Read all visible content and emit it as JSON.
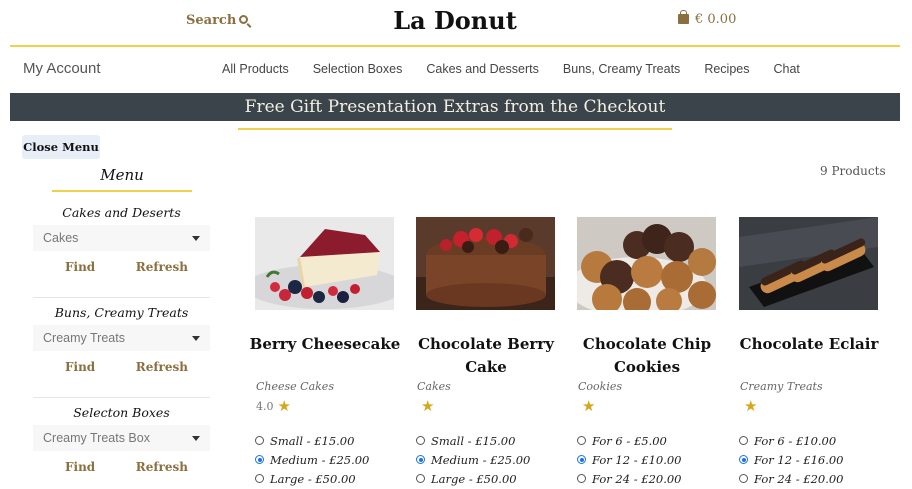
{
  "header": {
    "search_label": "Search",
    "logo": "La Donut",
    "cart_total": "€ 0.00"
  },
  "nav": {
    "account": "My Account",
    "links": [
      "All Products",
      "Selection Boxes",
      "Cakes and Desserts",
      "Buns, Creamy Treats",
      "Recipes",
      "Chat"
    ]
  },
  "banner": "Free Gift Presentation Extras from the Checkout",
  "sidebar": {
    "close_label": "Close Menu",
    "title": "Menu",
    "groups": [
      {
        "title": "Cakes and Deserts",
        "selected": "Cakes",
        "find": "Find",
        "refresh": "Refresh"
      },
      {
        "title": "Buns, Creamy Treats",
        "selected": "Creamy Treats",
        "find": "Find",
        "refresh": "Refresh"
      },
      {
        "title": "Selecton Boxes",
        "selected": "Creamy Treats Box",
        "find": "Find",
        "refresh": "Refresh"
      }
    ]
  },
  "product_count": "9 Products",
  "products": [
    {
      "name": "Berry Cheesecake",
      "category": "Cheese Cakes",
      "rating": "4.0",
      "options": [
        {
          "label": "Small - £15.00",
          "selected": false
        },
        {
          "label": "Medium - £25.00",
          "selected": true
        },
        {
          "label": "Large - £50.00",
          "selected": false
        }
      ]
    },
    {
      "name": "Chocolate Berry Cake",
      "category": "Cakes",
      "rating": "",
      "options": [
        {
          "label": "Small - £15.00",
          "selected": false
        },
        {
          "label": "Medium - £25.00",
          "selected": true
        },
        {
          "label": "Large - £50.00",
          "selected": false
        }
      ]
    },
    {
      "name": "Chocolate Chip Cookies",
      "category": "Cookies",
      "rating": "",
      "options": [
        {
          "label": "For 6 - £5.00",
          "selected": false
        },
        {
          "label": "For 12 - £10.00",
          "selected": true
        },
        {
          "label": "For 24 - £20.00",
          "selected": false
        }
      ]
    },
    {
      "name": "Chocolate Eclair",
      "category": "Creamy Treats",
      "rating": "",
      "options": [
        {
          "label": "For 6 - £10.00",
          "selected": false
        },
        {
          "label": "For 12 - £16.00",
          "selected": true
        },
        {
          "label": "For 24 - £20.00",
          "selected": false
        }
      ]
    }
  ],
  "colors": {
    "accent": "#f0d24a",
    "gold_text": "#8c6f3f",
    "banner_bg": "#3b444b",
    "star": "#d4a81a"
  }
}
